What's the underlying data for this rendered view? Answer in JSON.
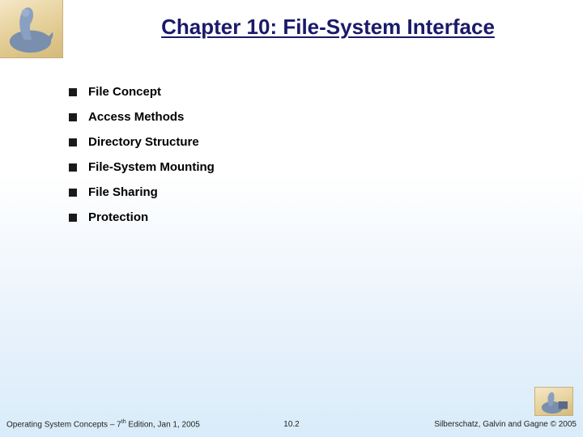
{
  "title": "Chapter 10:  File-System Interface",
  "bullets": [
    "File Concept",
    "Access Methods",
    "Directory Structure",
    "File-System Mounting",
    "File Sharing",
    "Protection"
  ],
  "footer": {
    "left_pre": "Operating System Concepts – 7",
    "left_sup": "th",
    "left_post": " Edition, Jan 1, 2005",
    "center": "10.2",
    "right": "Silberschatz, Galvin and Gagne © 2005"
  }
}
